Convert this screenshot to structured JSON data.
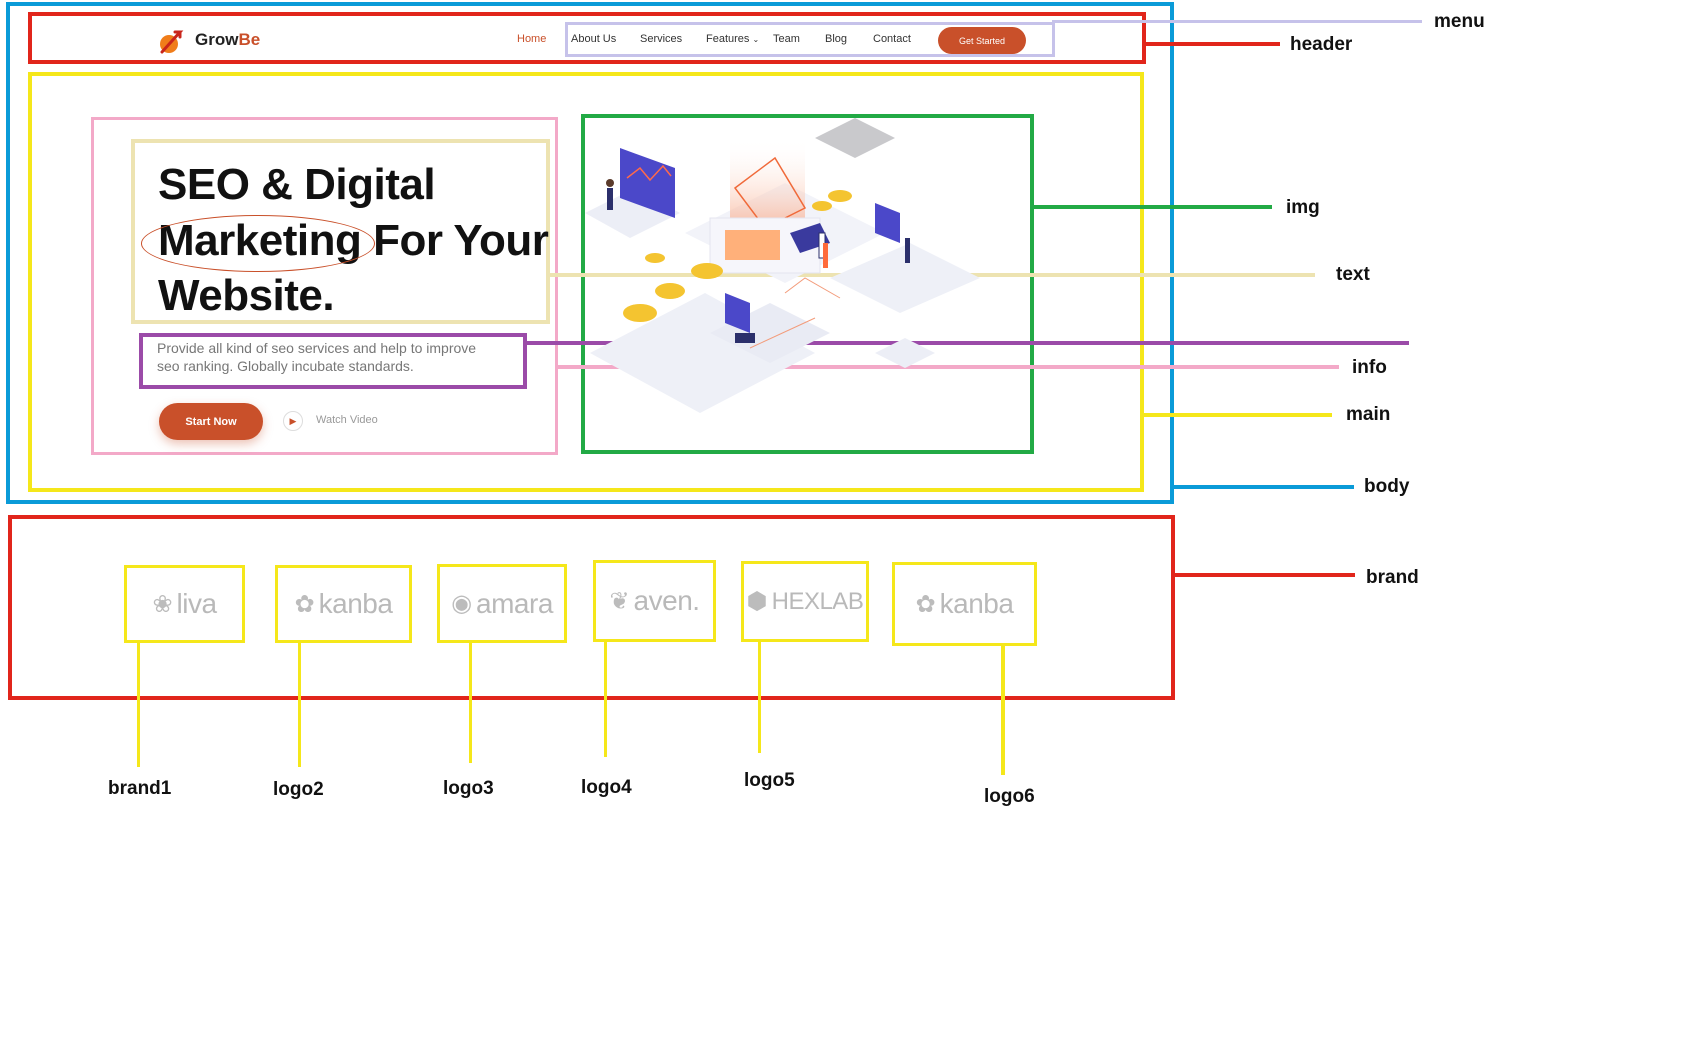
{
  "labels": {
    "menu": "menu",
    "header": "header",
    "img": "img",
    "text": "text",
    "info": "info",
    "main": "main",
    "body": "body",
    "brand": "brand",
    "brand1": "brand1",
    "logo2": "logo2",
    "logo3": "logo3",
    "logo4": "logo4",
    "logo5": "logo5",
    "logo6": "logo6"
  },
  "site": {
    "logo": {
      "grow": "Grow",
      "be": "Be"
    },
    "nav": {
      "home": "Home",
      "about": "About Us",
      "services": "Services",
      "features": "Features",
      "team": "Team",
      "blog": "Blog",
      "contact": "Contact",
      "cta": "Get Started"
    },
    "hero": {
      "line1": "SEO & Digital",
      "line2a": "Marketing",
      "line2b": "For Your",
      "line3": "Website.",
      "desc1": "Provide all kind of seo services and help to improve",
      "desc2": "seo ranking. Globally incubate standards.",
      "start": "Start Now",
      "watch": "Watch Video"
    },
    "brands": [
      "liva",
      "kanba",
      "amara",
      "aven.",
      "HEXLAB",
      "kanba"
    ]
  },
  "colors": {
    "body": "#0a9bd8",
    "header": "#e1251b",
    "menu": "#c6c2ea",
    "main": "#f5e71a",
    "img": "#22aa45",
    "text": "#ede3b1",
    "info": "#9b4ba8",
    "info_outer": "#f3a9c8",
    "accent": "#c9502a"
  },
  "icons": [
    "rocket-logo-icon",
    "chevron-down-icon",
    "play-icon",
    "isometric-illustration"
  ]
}
